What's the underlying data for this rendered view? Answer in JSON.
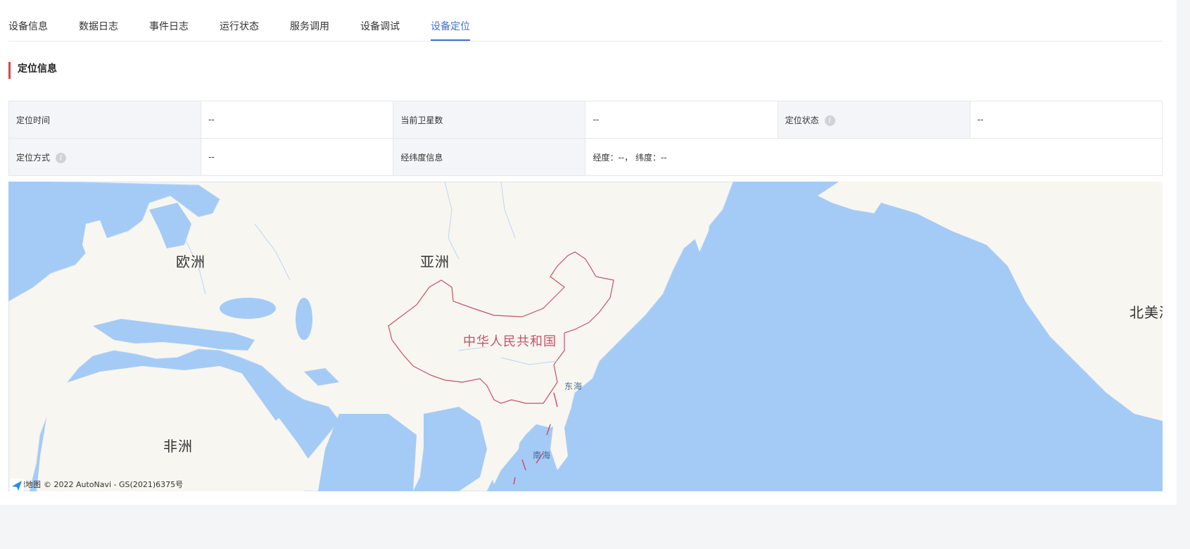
{
  "tabs": [
    {
      "label": "设备信息",
      "active": false
    },
    {
      "label": "数据日志",
      "active": false
    },
    {
      "label": "事件日志",
      "active": false
    },
    {
      "label": "运行状态",
      "active": false
    },
    {
      "label": "服务调用",
      "active": false
    },
    {
      "label": "设备调试",
      "active": false
    },
    {
      "label": "设备定位",
      "active": true
    }
  ],
  "section": {
    "title": "定位信息"
  },
  "info": {
    "row1": {
      "time_label": "定位时间",
      "time_value": "--",
      "sat_label": "当前卫星数",
      "sat_value": "--",
      "status_label": "定位状态",
      "status_value": "--"
    },
    "row2": {
      "method_label": "定位方式",
      "method_value": "--",
      "coord_label": "经纬度信息",
      "coord_value": "经度：--， 纬度：--"
    },
    "info_icon": "info-icon"
  },
  "map": {
    "labels": {
      "europe": "欧洲",
      "asia": "亚洲",
      "africa": "非洲",
      "north_america": "北美洲",
      "china": "中华人民共和国",
      "east_sea": "东海",
      "south_sea": "南海"
    },
    "logo_text": "高德地图",
    "copyright": "© 2022 AutoNavi - GS(2021)6375号",
    "colors": {
      "water": "#a4cbf6",
      "land": "#f8f6f0",
      "border": "#c8516b"
    }
  },
  "colors": {
    "accent": "#3d6fd8",
    "section_marker": "#e0414b"
  }
}
